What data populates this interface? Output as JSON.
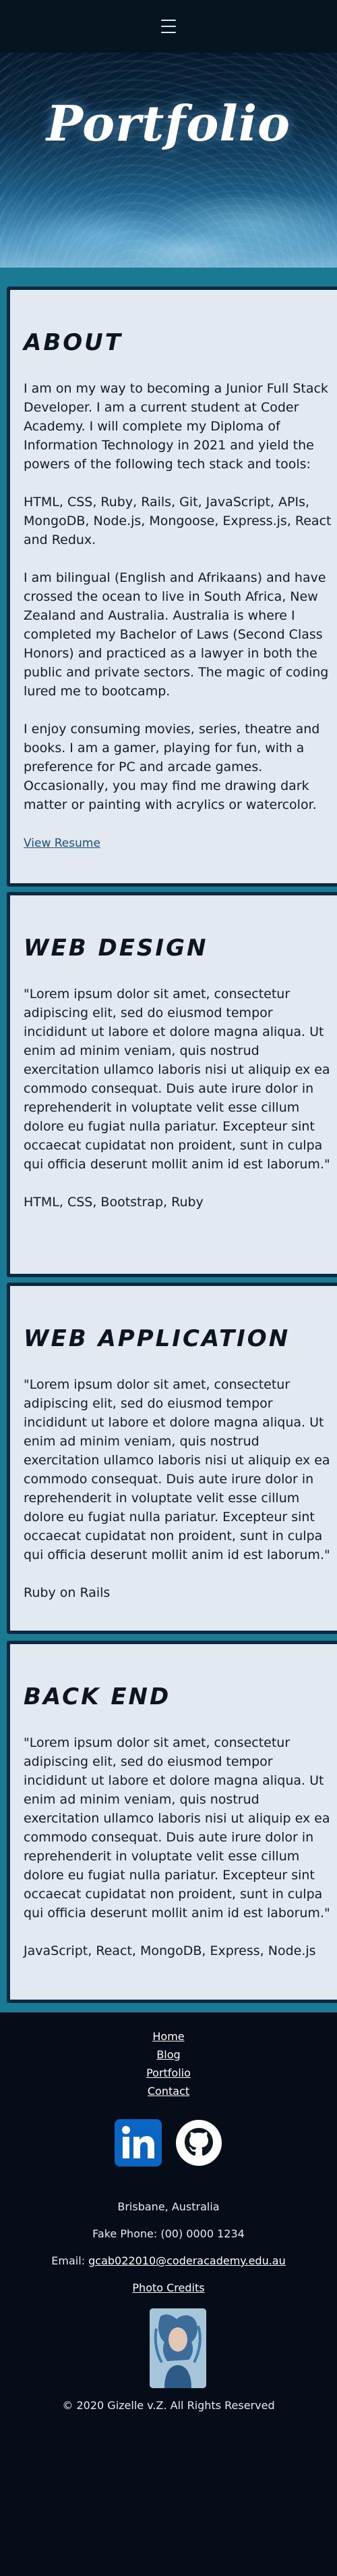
{
  "hero": {
    "title": "Portfolio"
  },
  "about": {
    "heading": "About",
    "paragraphs": [
      "I am on my way to becoming a Junior Full Stack Developer. I am a current student at Coder Academy. I will complete my Diploma of Information Technology in 2021 and yield the powers of the following tech stack and tools:",
      "HTML, CSS, Ruby, Rails, Git, JavaScript, APIs, MongoDB, Node.js, Mongoose, Express.js, React and Redux.",
      "I am bilingual (English and Afrikaans) and have crossed the ocean to live in South Africa, New Zealand and Australia. Australia is where I completed my Bachelor of Laws (Second Class Honors) and practiced as a lawyer in both the public and private sectors. The magic of coding lured me to bootcamp.",
      "I enjoy consuming movies, series, theatre and books. I am a gamer, playing for fun, with a preference for PC and arcade games. Occasionally, you may find me drawing dark matter or painting with acrylics or watercolor."
    ],
    "link": "View Resume"
  },
  "sections": [
    {
      "heading": "Web Design",
      "text": "\"Lorem ipsum dolor sit amet, consectetur adipiscing elit, sed do eiusmod tempor incididunt ut labore et dolore magna aliqua. Ut enim ad minim veniam, quis nostrud exercitation ullamco laboris nisi ut aliquip ex ea commodo consequat. Duis aute irure dolor in reprehenderit in voluptate velit esse cillum dolore eu fugiat nulla pariatur. Excepteur sint occaecat cupidatat non proident, sunt in culpa qui officia deserunt mollit anim id est laborum.\"",
      "stack": "HTML, CSS, Bootstrap, Ruby"
    },
    {
      "heading": "Web Application",
      "text": "\"Lorem ipsum dolor sit amet, consectetur adipiscing elit, sed do eiusmod tempor incididunt ut labore et dolore magna aliqua. Ut enim ad minim veniam, quis nostrud exercitation ullamco laboris nisi ut aliquip ex ea commodo consequat. Duis aute irure dolor in reprehenderit in voluptate velit esse cillum dolore eu fugiat nulla pariatur. Excepteur sint occaecat cupidatat non proident, sunt in culpa qui officia deserunt mollit anim id est laborum.\"",
      "stack": "Ruby on Rails"
    },
    {
      "heading": "Back End",
      "text": "\"Lorem ipsum dolor sit amet, consectetur adipiscing elit, sed do eiusmod tempor incididunt ut labore et dolore magna aliqua. Ut enim ad minim veniam, quis nostrud exercitation ullamco laboris nisi ut aliquip ex ea commodo consequat. Duis aute irure dolor in reprehenderit in voluptate velit esse cillum dolore eu fugiat nulla pariatur. Excepteur sint occaecat cupidatat non proident, sunt in culpa qui officia deserunt mollit anim id est laborum.\"",
      "stack": "JavaScript, React, MongoDB, Express, Node.js"
    }
  ],
  "footer": {
    "nav": [
      "Home",
      "Blog",
      "Portfolio",
      "Contact"
    ],
    "social": {
      "linkedin": "linkedin-icon",
      "github": "github-icon"
    },
    "location": "Brisbane, Australia",
    "phone": "Fake Phone: (00) 0000 1234",
    "email_label": "Email: ",
    "email": "gcab022010@coderacademy.edu.au",
    "credits": "Photo Credits",
    "copyright": "© 2020 Gizelle v.Z. All Rights Reserved"
  },
  "colors": {
    "topbar": "#06141f",
    "main_bg": "#1b7a93",
    "card_bg": "#e2e9ef",
    "card_border": "#0b2a40",
    "footer_bg": "#050d18",
    "linkedin": "#0a66c2"
  }
}
